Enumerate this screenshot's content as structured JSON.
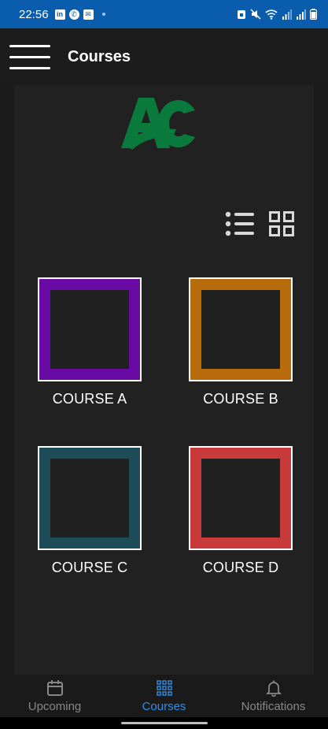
{
  "status_bar": {
    "time": "22:56",
    "notification_icons": [
      "linkedin-icon",
      "whatsapp-icon",
      "mail-icon"
    ],
    "system_icons": [
      "alarm-icon",
      "mute-icon",
      "wifi-icon",
      "signal-icon",
      "signal-icon",
      "battery-icon"
    ],
    "background_color": "#0a5cad"
  },
  "app_bar": {
    "title": "Courses",
    "menu_icon": "hamburger-menu-icon"
  },
  "logo": {
    "text": "AC",
    "color": "#0a7a3c"
  },
  "view_toggle": {
    "list_icon": "list-view-icon",
    "grid_icon": "grid-view-icon"
  },
  "courses": [
    {
      "label": "COURSE A",
      "color": "#6a0aa5"
    },
    {
      "label": "COURSE B",
      "color": "#b86b0b"
    },
    {
      "label": "COURSE C",
      "color": "#1c4d58"
    },
    {
      "label": "COURSE D",
      "color": "#c83a3a"
    }
  ],
  "bottom_nav": {
    "items": [
      {
        "label": "Upcoming",
        "icon": "calendar-icon",
        "active": false
      },
      {
        "label": "Courses",
        "icon": "grid-dots-icon",
        "active": true
      },
      {
        "label": "Notifications",
        "icon": "bell-icon",
        "active": false
      }
    ],
    "active_color": "#2f8fe8"
  }
}
